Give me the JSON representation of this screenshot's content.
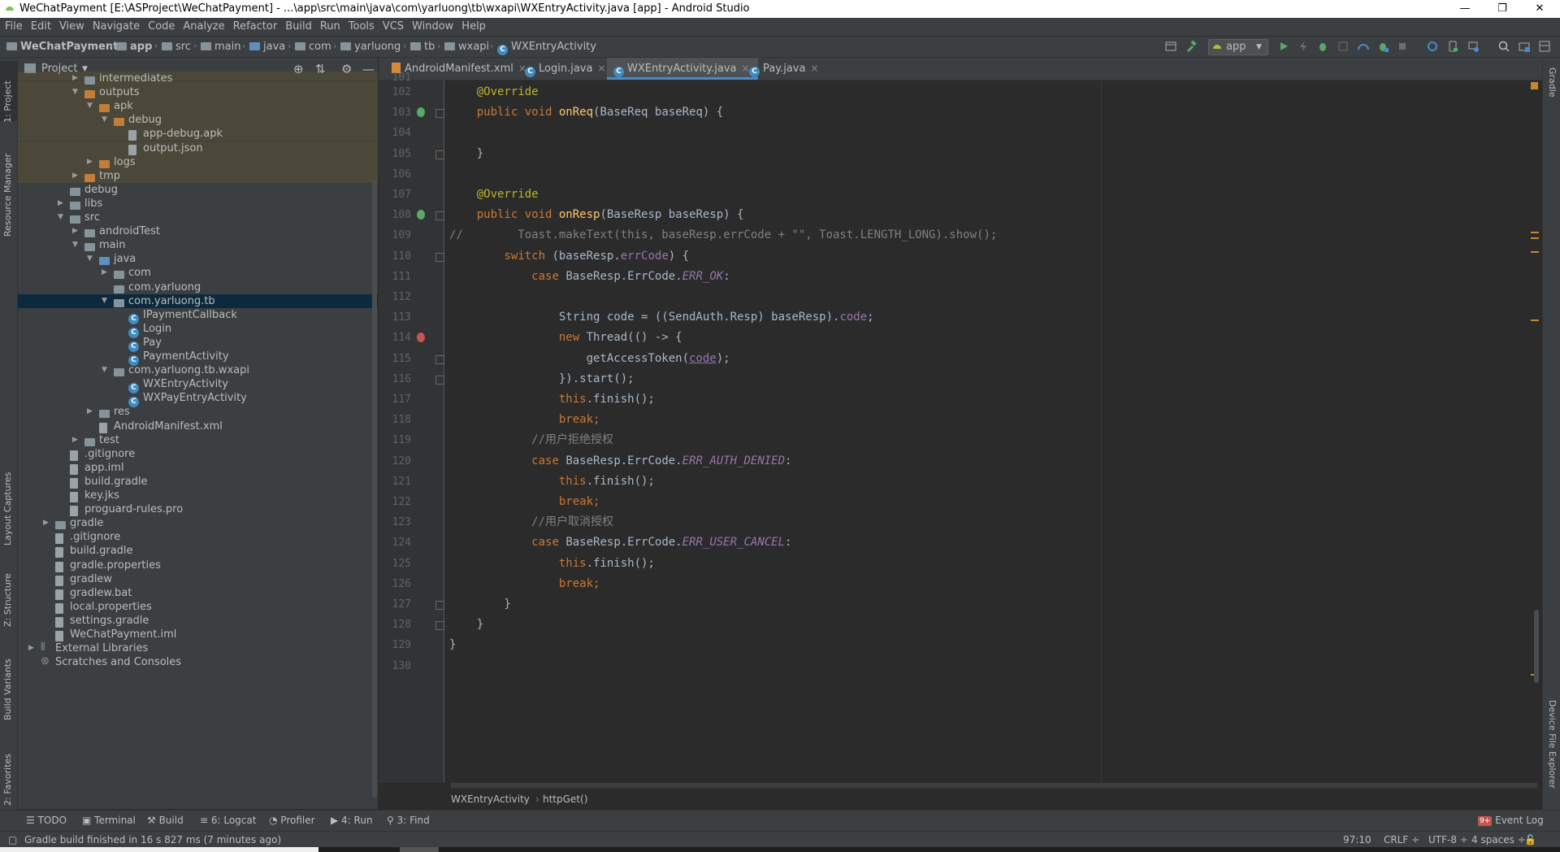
{
  "window": {
    "title": "WeChatPayment [E:\\ASProject\\WeChatPayment] - ...\\app\\src\\main\\java\\com\\yarluong\\tb\\wxapi\\WXEntryActivity.java [app] - Android Studio",
    "minimize": "—",
    "maximize": "❐",
    "close": "✕"
  },
  "menu": [
    "File",
    "Edit",
    "View",
    "Navigate",
    "Code",
    "Analyze",
    "Refactor",
    "Build",
    "Run",
    "Tools",
    "VCS",
    "Window",
    "Help"
  ],
  "nav": {
    "crumbs": [
      "WeChatPayment",
      "app",
      "src",
      "main",
      "java",
      "com",
      "yarluong",
      "tb",
      "wxapi",
      "WXEntryActivity"
    ],
    "run_config": "app"
  },
  "left_tabs": [
    "1: Project",
    "Resource Manager",
    "Layout Captures",
    "Z: Structure",
    "Build Variants",
    "2: Favorites"
  ],
  "right_tabs": [
    "Gradle",
    "Device File Explorer"
  ],
  "project": {
    "view": "Project",
    "tree": [
      {
        "label": "intermediates",
        "depth": 3,
        "arrow": "▶",
        "icon": "folder",
        "hl": true
      },
      {
        "label": "outputs",
        "depth": 3,
        "arrow": "▼",
        "icon": "folder-orange",
        "hl": true
      },
      {
        "label": "apk",
        "depth": 4,
        "arrow": "▼",
        "icon": "folder-orange",
        "hl": true
      },
      {
        "label": "debug",
        "depth": 5,
        "arrow": "▼",
        "icon": "folder-orange",
        "hl": true
      },
      {
        "label": "app-debug.apk",
        "depth": 6,
        "arrow": "",
        "icon": "file",
        "hl": true
      },
      {
        "label": "output.json",
        "depth": 6,
        "arrow": "",
        "icon": "file",
        "hl": true
      },
      {
        "label": "logs",
        "depth": 4,
        "arrow": "▶",
        "icon": "folder-orange",
        "hl": true
      },
      {
        "label": "tmp",
        "depth": 3,
        "arrow": "▶",
        "icon": "folder-orange",
        "hl": true
      },
      {
        "label": "debug",
        "depth": 2,
        "arrow": "",
        "icon": "folder",
        "hl": false
      },
      {
        "label": "libs",
        "depth": 2,
        "arrow": "▶",
        "icon": "folder",
        "hl": false
      },
      {
        "label": "src",
        "depth": 2,
        "arrow": "▼",
        "icon": "folder",
        "hl": false
      },
      {
        "label": "androidTest",
        "depth": 3,
        "arrow": "▶",
        "icon": "folder",
        "hl": false
      },
      {
        "label": "main",
        "depth": 3,
        "arrow": "▼",
        "icon": "folder",
        "hl": false
      },
      {
        "label": "java",
        "depth": 4,
        "arrow": "▼",
        "icon": "folder-blue",
        "hl": false
      },
      {
        "label": "com",
        "depth": 5,
        "arrow": "▶",
        "icon": "folder",
        "hl": false
      },
      {
        "label": "com.yarluong",
        "depth": 5,
        "arrow": "",
        "icon": "folder",
        "hl": false
      },
      {
        "label": "com.yarluong.tb",
        "depth": 5,
        "arrow": "▼",
        "icon": "folder",
        "hl": false,
        "sel": true
      },
      {
        "label": "IPaymentCallback",
        "depth": 6,
        "arrow": "",
        "icon": "class",
        "hl": false
      },
      {
        "label": "Login",
        "depth": 6,
        "arrow": "",
        "icon": "class",
        "hl": false
      },
      {
        "label": "Pay",
        "depth": 6,
        "arrow": "",
        "icon": "class",
        "hl": false
      },
      {
        "label": "PaymentActivity",
        "depth": 6,
        "arrow": "",
        "icon": "class",
        "hl": false
      },
      {
        "label": "com.yarluong.tb.wxapi",
        "depth": 5,
        "arrow": "▼",
        "icon": "folder",
        "hl": false
      },
      {
        "label": "WXEntryActivity",
        "depth": 6,
        "arrow": "",
        "icon": "class",
        "hl": false
      },
      {
        "label": "WXPayEntryActivity",
        "depth": 6,
        "arrow": "",
        "icon": "class",
        "hl": false
      },
      {
        "label": "res",
        "depth": 4,
        "arrow": "▶",
        "icon": "folder",
        "hl": false
      },
      {
        "label": "AndroidManifest.xml",
        "depth": 4,
        "arrow": "",
        "icon": "file",
        "hl": false
      },
      {
        "label": "test",
        "depth": 3,
        "arrow": "▶",
        "icon": "folder",
        "hl": false
      },
      {
        "label": ".gitignore",
        "depth": 2,
        "arrow": "",
        "icon": "file",
        "hl": false
      },
      {
        "label": "app.iml",
        "depth": 2,
        "arrow": "",
        "icon": "file",
        "hl": false
      },
      {
        "label": "build.gradle",
        "depth": 2,
        "arrow": "",
        "icon": "file",
        "hl": false
      },
      {
        "label": "key.jks",
        "depth": 2,
        "arrow": "",
        "icon": "file",
        "hl": false
      },
      {
        "label": "proguard-rules.pro",
        "depth": 2,
        "arrow": "",
        "icon": "file",
        "hl": false
      },
      {
        "label": "gradle",
        "depth": 1,
        "arrow": "▶",
        "icon": "folder",
        "hl": false
      },
      {
        "label": ".gitignore",
        "depth": 1,
        "arrow": "",
        "icon": "file",
        "hl": false
      },
      {
        "label": "build.gradle",
        "depth": 1,
        "arrow": "",
        "icon": "file",
        "hl": false
      },
      {
        "label": "gradle.properties",
        "depth": 1,
        "arrow": "",
        "icon": "file",
        "hl": false
      },
      {
        "label": "gradlew",
        "depth": 1,
        "arrow": "",
        "icon": "file",
        "hl": false
      },
      {
        "label": "gradlew.bat",
        "depth": 1,
        "arrow": "",
        "icon": "file",
        "hl": false
      },
      {
        "label": "local.properties",
        "depth": 1,
        "arrow": "",
        "icon": "file",
        "hl": false
      },
      {
        "label": "settings.gradle",
        "depth": 1,
        "arrow": "",
        "icon": "file",
        "hl": false
      },
      {
        "label": "WeChatPayment.iml",
        "depth": 1,
        "arrow": "",
        "icon": "file",
        "hl": false
      },
      {
        "label": "External Libraries",
        "depth": 0,
        "arrow": "▶",
        "icon": "lib",
        "hl": false
      },
      {
        "label": "Scratches and Consoles",
        "depth": 0,
        "arrow": "",
        "icon": "scratch",
        "hl": false
      }
    ]
  },
  "tabs": [
    {
      "label": "AndroidManifest.xml",
      "icon": "xml",
      "active": false
    },
    {
      "label": "Login.java",
      "icon": "class",
      "active": false
    },
    {
      "label": "WXEntryActivity.java",
      "icon": "class",
      "active": true
    },
    {
      "label": "Pay.java",
      "icon": "class",
      "active": false
    }
  ],
  "editor": {
    "first_line_partial": "101",
    "lines": [
      {
        "n": "102",
        "html": "    <span class='an'>@Override</span>"
      },
      {
        "n": "103",
        "html": "    <span class='kw'>public void </span><span class='fn'>onReq</span>(BaseReq baseReq) {"
      },
      {
        "n": "104",
        "html": ""
      },
      {
        "n": "105",
        "html": "    }"
      },
      {
        "n": "106",
        "html": ""
      },
      {
        "n": "107",
        "html": "    <span class='an'>@Override</span>"
      },
      {
        "n": "108",
        "html": "    <span class='kw'>public void </span><span class='fn'>onResp</span>(BaseResp baseResp) {"
      },
      {
        "n": "109",
        "html": "<span class='cm'>//        Toast.makeText(this, baseResp.errCode + \"\", Toast.LENGTH_LONG).show();</span>"
      },
      {
        "n": "110",
        "html": "        <span class='kw'>switch </span>(baseResp.<span class='fld'>errCode</span>) {"
      },
      {
        "n": "111",
        "html": "            <span class='kw'>case </span>BaseResp.ErrCode.<span class='it'>ERR_OK</span>:"
      },
      {
        "n": "112",
        "html": ""
      },
      {
        "n": "113",
        "html": "                String code = ((SendAuth.Resp) baseResp).<span class='fld'>code</span>;"
      },
      {
        "n": "114",
        "html": "                <span class='kw'>new </span>Thread(() -> {"
      },
      {
        "n": "115",
        "html": "                    getAccessToken(<span class='fld ul'>code</span>);"
      },
      {
        "n": "116",
        "html": "                }).start();"
      },
      {
        "n": "117",
        "html": "                <span class='kw'>this</span>.finish();"
      },
      {
        "n": "118",
        "html": "                <span class='kw'>break;</span>"
      },
      {
        "n": "119",
        "html": "            <span class='cm'>//用户拒绝授权</span>"
      },
      {
        "n": "120",
        "html": "            <span class='kw'>case </span>BaseResp.ErrCode.<span class='it'>ERR_AUTH_DENIED</span>:"
      },
      {
        "n": "121",
        "html": "                <span class='kw'>this</span>.finish();"
      },
      {
        "n": "122",
        "html": "                <span class='kw'>break;</span>"
      },
      {
        "n": "123",
        "html": "            <span class='cm'>//用户取消授权</span>"
      },
      {
        "n": "124",
        "html": "            <span class='kw'>case </span>BaseResp.ErrCode.<span class='it'>ERR_USER_CANCEL</span>:"
      },
      {
        "n": "125",
        "html": "                <span class='kw'>this</span>.finish();"
      },
      {
        "n": "126",
        "html": "                <span class='kw'>break;</span>"
      },
      {
        "n": "127",
        "html": "        }"
      },
      {
        "n": "128",
        "html": "    }"
      },
      {
        "n": "129",
        "html": "}"
      },
      {
        "n": "130",
        "html": ""
      }
    ]
  },
  "code_crumbs": [
    "WXEntryActivity",
    "httpGet()"
  ],
  "tool_windows": [
    "TODO",
    "Terminal",
    "Build",
    "6: Logcat",
    "Profiler",
    "4: Run",
    "3: Find"
  ],
  "event_log": "Event Log",
  "event_badge": "9+",
  "status": {
    "message": "Gradle build finished in 16 s 827 ms (7 minutes ago)",
    "position": "97:10",
    "line_sep": "CRLF ÷",
    "encoding": "UTF-8 ÷",
    "indent": "4 spaces ÷"
  }
}
